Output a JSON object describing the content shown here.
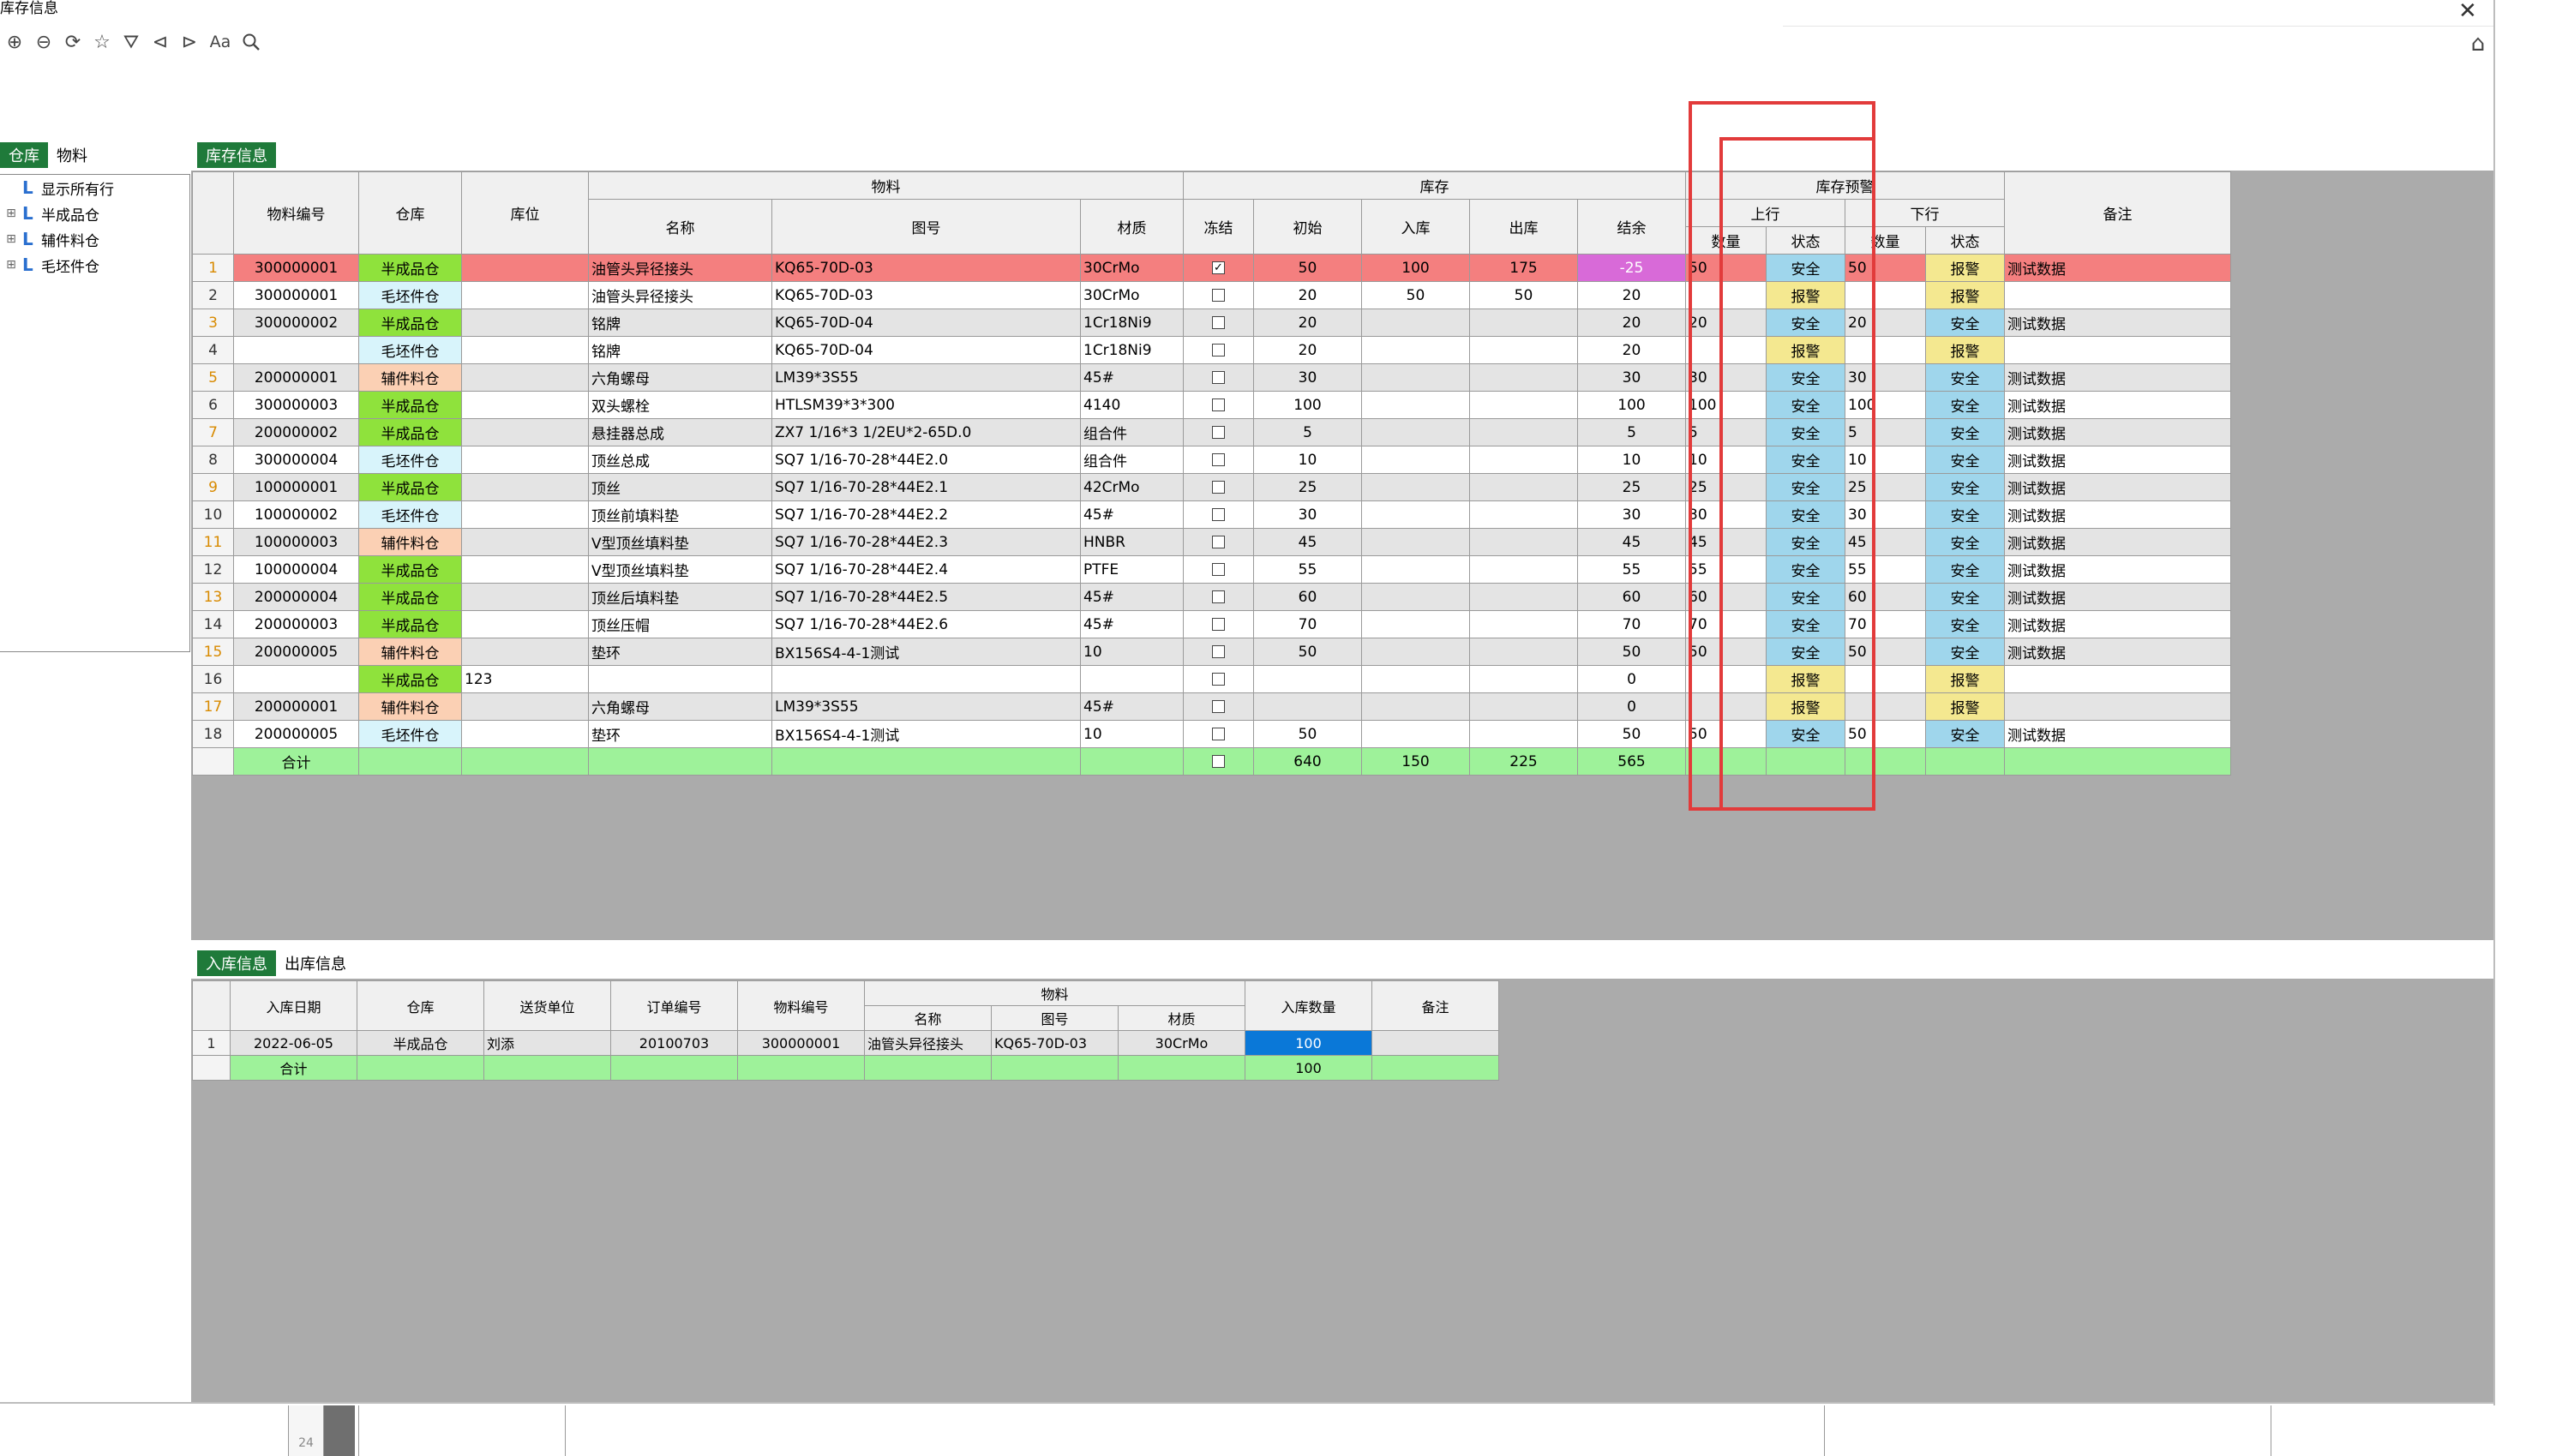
{
  "window": {
    "title": "库存信息"
  },
  "toolbar": {
    "icons": [
      "add-circle-icon",
      "remove-circle-icon",
      "refresh-icon",
      "star-icon",
      "filter-icon",
      "back-circle-icon",
      "forward-circle-icon",
      "font-size-icon",
      "search-icon"
    ],
    "font_label": "Aa"
  },
  "left_tabs": [
    "仓库",
    "物料"
  ],
  "tree": {
    "items": [
      {
        "label": "显示所有行",
        "expandable": false
      },
      {
        "label": "半成品仓",
        "expandable": true
      },
      {
        "label": "辅件料仓",
        "expandable": true
      },
      {
        "label": "毛坯件仓",
        "expandable": true
      }
    ]
  },
  "top_tab": "库存信息",
  "main_table": {
    "headers": {
      "code": "物料编号",
      "warehouse": "仓库",
      "location": "库位",
      "material_group": "物料",
      "name": "名称",
      "drawing": "图号",
      "texture": "材质",
      "stock_group": "库存",
      "frozen": "冻结",
      "initial": "初始",
      "in": "入库",
      "out": "出库",
      "balance": "结余",
      "warning_group": "库存预警",
      "upper": "上行",
      "lower": "下行",
      "qty": "数量",
      "status": "状态",
      "remark": "备注"
    },
    "rows": [
      {
        "n": "1",
        "code": "300000001",
        "wh": "半成品仓",
        "loc": "",
        "name": "油管头异径接头",
        "drawing": "KQ65-70D-03",
        "tex": "30CrMo",
        "frozen": true,
        "init": "50",
        "in": "100",
        "out": "175",
        "bal": "-25",
        "uq": "50",
        "us": "安全",
        "lq": "50",
        "ls": "报警",
        "rem": "测试数据"
      },
      {
        "n": "2",
        "code": "300000001",
        "wh": "毛坯件仓",
        "loc": "",
        "name": "油管头异径接头",
        "drawing": "KQ65-70D-03",
        "tex": "30CrMo",
        "frozen": false,
        "init": "20",
        "in": "50",
        "out": "50",
        "bal": "20",
        "uq": "",
        "us": "报警",
        "lq": "",
        "ls": "报警",
        "rem": ""
      },
      {
        "n": "3",
        "code": "300000002",
        "wh": "半成品仓",
        "loc": "",
        "name": "铭牌",
        "drawing": "KQ65-70D-04",
        "tex": "1Cr18Ni9",
        "frozen": false,
        "init": "20",
        "in": "",
        "out": "",
        "bal": "20",
        "uq": "20",
        "us": "安全",
        "lq": "20",
        "ls": "安全",
        "rem": "测试数据"
      },
      {
        "n": "4",
        "code": "",
        "wh": "毛坯件仓",
        "loc": "",
        "name": "铭牌",
        "drawing": "KQ65-70D-04",
        "tex": "1Cr18Ni9",
        "frozen": false,
        "init": "20",
        "in": "",
        "out": "",
        "bal": "20",
        "uq": "",
        "us": "报警",
        "lq": "",
        "ls": "报警",
        "rem": ""
      },
      {
        "n": "5",
        "code": "200000001",
        "wh": "辅件料仓",
        "loc": "",
        "name": "六角螺母",
        "drawing": "LM39*3S55",
        "tex": "45#",
        "frozen": false,
        "init": "30",
        "in": "",
        "out": "",
        "bal": "30",
        "uq": "30",
        "us": "安全",
        "lq": "30",
        "ls": "安全",
        "rem": "测试数据"
      },
      {
        "n": "6",
        "code": "300000003",
        "wh": "半成品仓",
        "loc": "",
        "name": "双头螺栓",
        "drawing": "HTLSM39*3*300",
        "tex": "4140",
        "frozen": false,
        "init": "100",
        "in": "",
        "out": "",
        "bal": "100",
        "uq": "100",
        "us": "安全",
        "lq": "100",
        "ls": "安全",
        "rem": "测试数据"
      },
      {
        "n": "7",
        "code": "200000002",
        "wh": "半成品仓",
        "loc": "",
        "name": "悬挂器总成",
        "drawing": "ZX7 1/16*3 1/2EU*2-65D.0",
        "tex": "组合件",
        "frozen": false,
        "init": "5",
        "in": "",
        "out": "",
        "bal": "5",
        "uq": "5",
        "us": "安全",
        "lq": "5",
        "ls": "安全",
        "rem": "测试数据"
      },
      {
        "n": "8",
        "code": "300000004",
        "wh": "毛坯件仓",
        "loc": "",
        "name": "顶丝总成",
        "drawing": "SQ7 1/16-70-28*44E2.0",
        "tex": "组合件",
        "frozen": false,
        "init": "10",
        "in": "",
        "out": "",
        "bal": "10",
        "uq": "10",
        "us": "安全",
        "lq": "10",
        "ls": "安全",
        "rem": "测试数据"
      },
      {
        "n": "9",
        "code": "100000001",
        "wh": "半成品仓",
        "loc": "",
        "name": "顶丝",
        "drawing": "SQ7 1/16-70-28*44E2.1",
        "tex": "42CrMo",
        "frozen": false,
        "init": "25",
        "in": "",
        "out": "",
        "bal": "25",
        "uq": "25",
        "us": "安全",
        "lq": "25",
        "ls": "安全",
        "rem": "测试数据"
      },
      {
        "n": "10",
        "code": "100000002",
        "wh": "毛坯件仓",
        "loc": "",
        "name": "顶丝前填料垫",
        "drawing": "SQ7 1/16-70-28*44E2.2",
        "tex": "45#",
        "frozen": false,
        "init": "30",
        "in": "",
        "out": "",
        "bal": "30",
        "uq": "30",
        "us": "安全",
        "lq": "30",
        "ls": "安全",
        "rem": "测试数据"
      },
      {
        "n": "11",
        "code": "100000003",
        "wh": "辅件料仓",
        "loc": "",
        "name": "V型顶丝填料垫",
        "drawing": "SQ7 1/16-70-28*44E2.3",
        "tex": "HNBR",
        "frozen": false,
        "init": "45",
        "in": "",
        "out": "",
        "bal": "45",
        "uq": "45",
        "us": "安全",
        "lq": "45",
        "ls": "安全",
        "rem": "测试数据"
      },
      {
        "n": "12",
        "code": "100000004",
        "wh": "半成品仓",
        "loc": "",
        "name": "V型顶丝填料垫",
        "drawing": "SQ7 1/16-70-28*44E2.4",
        "tex": "PTFE",
        "frozen": false,
        "init": "55",
        "in": "",
        "out": "",
        "bal": "55",
        "uq": "55",
        "us": "安全",
        "lq": "55",
        "ls": "安全",
        "rem": "测试数据"
      },
      {
        "n": "13",
        "code": "200000004",
        "wh": "半成品仓",
        "loc": "",
        "name": "顶丝后填料垫",
        "drawing": "SQ7 1/16-70-28*44E2.5",
        "tex": "45#",
        "frozen": false,
        "init": "60",
        "in": "",
        "out": "",
        "bal": "60",
        "uq": "60",
        "us": "安全",
        "lq": "60",
        "ls": "安全",
        "rem": "测试数据"
      },
      {
        "n": "14",
        "code": "200000003",
        "wh": "半成品仓",
        "loc": "",
        "name": "顶丝压帽",
        "drawing": "SQ7 1/16-70-28*44E2.6",
        "tex": "45#",
        "frozen": false,
        "init": "70",
        "in": "",
        "out": "",
        "bal": "70",
        "uq": "70",
        "us": "安全",
        "lq": "70",
        "ls": "安全",
        "rem": "测试数据"
      },
      {
        "n": "15",
        "code": "200000005",
        "wh": "辅件料仓",
        "loc": "",
        "name": "垫环",
        "drawing": "BX156S4-4-1测试",
        "tex": "10",
        "frozen": false,
        "init": "50",
        "in": "",
        "out": "",
        "bal": "50",
        "uq": "50",
        "us": "安全",
        "lq": "50",
        "ls": "安全",
        "rem": "测试数据"
      },
      {
        "n": "16",
        "code": "",
        "wh": "半成品仓",
        "loc": "123",
        "name": "",
        "drawing": "",
        "tex": "",
        "frozen": false,
        "init": "",
        "in": "",
        "out": "",
        "bal": "0",
        "uq": "",
        "us": "报警",
        "lq": "",
        "ls": "报警",
        "rem": ""
      },
      {
        "n": "17",
        "code": "200000001",
        "wh": "辅件料仓",
        "loc": "",
        "name": "六角螺母",
        "drawing": "LM39*3S55",
        "tex": "45#",
        "frozen": false,
        "init": "",
        "in": "",
        "out": "",
        "bal": "0",
        "uq": "",
        "us": "报警",
        "lq": "",
        "ls": "报警",
        "rem": ""
      },
      {
        "n": "18",
        "code": "200000005",
        "wh": "毛坯件仓",
        "loc": "",
        "name": "垫环",
        "drawing": "BX156S4-4-1测试",
        "tex": "10",
        "frozen": false,
        "init": "50",
        "in": "",
        "out": "",
        "bal": "50",
        "uq": "50",
        "us": "安全",
        "lq": "50",
        "ls": "安全",
        "rem": "测试数据"
      }
    ],
    "sum": {
      "label": "合计",
      "init": "640",
      "in": "150",
      "out": "225",
      "bal": "565"
    }
  },
  "bottom_tabs": [
    "入库信息",
    "出库信息"
  ],
  "bottom_table": {
    "headers": {
      "date": "入库日期",
      "warehouse": "仓库",
      "supplier": "送货单位",
      "order": "订单编号",
      "code": "物料编号",
      "material_group": "物料",
      "name": "名称",
      "drawing": "图号",
      "texture": "材质",
      "qty": "入库数量",
      "remark": "备注"
    },
    "rows": [
      {
        "n": "1",
        "date": "2022-06-05",
        "wh": "半成品仓",
        "sup": "刘添",
        "order": "20100703",
        "code": "300000001",
        "name": "油管头异径接头",
        "drawing": "KQ65-70D-03",
        "tex": "30CrMo",
        "qty": "100",
        "rem": ""
      }
    ],
    "sum": {
      "label": "合计",
      "qty": "100"
    }
  },
  "colors": {
    "tab_active": "#1f7a3a",
    "semi": "#8fe23c",
    "blank": "#d8f4fb",
    "aux": "#fbd0b4",
    "safe": "#9fd6ec",
    "warn": "#f4e890",
    "row_red": "#f47f7f",
    "negative": "#d86ad8",
    "sum": "#9ef29a",
    "selected": "#0a78d8",
    "highlight": "#e23b3b",
    "grid_bg": "#ababab"
  },
  "footer": {
    "ruler_value": "24"
  }
}
